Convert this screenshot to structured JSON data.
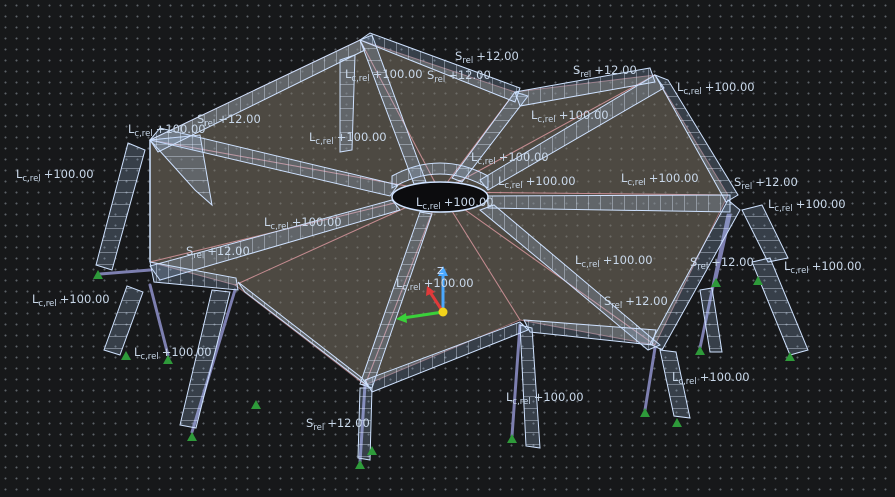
{
  "viewport": {
    "background": "#17181a",
    "grid_color": "#5a6068",
    "structure_color": "#cfe2ff",
    "plate_color": "#7a7264",
    "support_color": "#2e9a3a"
  },
  "labels": [
    {
      "sym": "L",
      "sub": "c,rel",
      "val": "+100.00"
    },
    {
      "sym": "L",
      "sub": "c,rel",
      "val": "+100.00"
    },
    {
      "sym": "L",
      "sub": "c,rel",
      "val": "+100.00"
    },
    {
      "sym": "L",
      "sub": "c,rel",
      "val": "+100.00"
    },
    {
      "sym": "L",
      "sub": "c,rel",
      "val": "+100.00"
    },
    {
      "sym": "L",
      "sub": "c,rel",
      "val": "+100.00"
    },
    {
      "sym": "L",
      "sub": "c,rel",
      "val": "+100.00"
    },
    {
      "sym": "L",
      "sub": "c,rel",
      "val": "+100.00"
    },
    {
      "sym": "L",
      "sub": "c,rel",
      "val": "+100.00"
    },
    {
      "sym": "L",
      "sub": "c,rel",
      "val": "+100.00"
    },
    {
      "sym": "L",
      "sub": "c,rel",
      "val": "+100.00"
    },
    {
      "sym": "L",
      "sub": "c,rel",
      "val": "+100.00"
    },
    {
      "sym": "L",
      "sub": "c,rel",
      "val": "+100.00"
    },
    {
      "sym": "L",
      "sub": "c,rel",
      "val": "+100.00"
    },
    {
      "sym": "L",
      "sub": "c,rel",
      "val": "+100.00"
    },
    {
      "sym": "L",
      "sub": "c,rel",
      "val": "+100.00"
    },
    {
      "sym": "L",
      "sub": "c,rel",
      "val": "+100.00"
    },
    {
      "sym": "L",
      "sub": "c,rel",
      "val": "+100.00"
    },
    {
      "sym": "L",
      "sub": "c,rel",
      "val": "+100.00"
    },
    {
      "sym": "S",
      "sub": "rel",
      "val": "+12.00"
    },
    {
      "sym": "S",
      "sub": "rel",
      "val": "+12.00"
    },
    {
      "sym": "S",
      "sub": "rel",
      "val": "+12.00"
    },
    {
      "sym": "S",
      "sub": "rel",
      "val": "+12.00"
    },
    {
      "sym": "S",
      "sub": "rel",
      "val": "+12.00"
    },
    {
      "sym": "S",
      "sub": "rel",
      "val": "+12.00"
    },
    {
      "sym": "S",
      "sub": "rel",
      "val": "+12.00"
    },
    {
      "sym": "S",
      "sub": "rel",
      "val": "+12.00"
    },
    {
      "sym": "S",
      "sub": "rel",
      "val": "+12.00"
    }
  ],
  "axes": {
    "z_label": "Z",
    "x_color": "#e03a3a",
    "y_color": "#3ad13a",
    "z_color": "#4aa8ff",
    "origin_color": "#f2d21a"
  }
}
